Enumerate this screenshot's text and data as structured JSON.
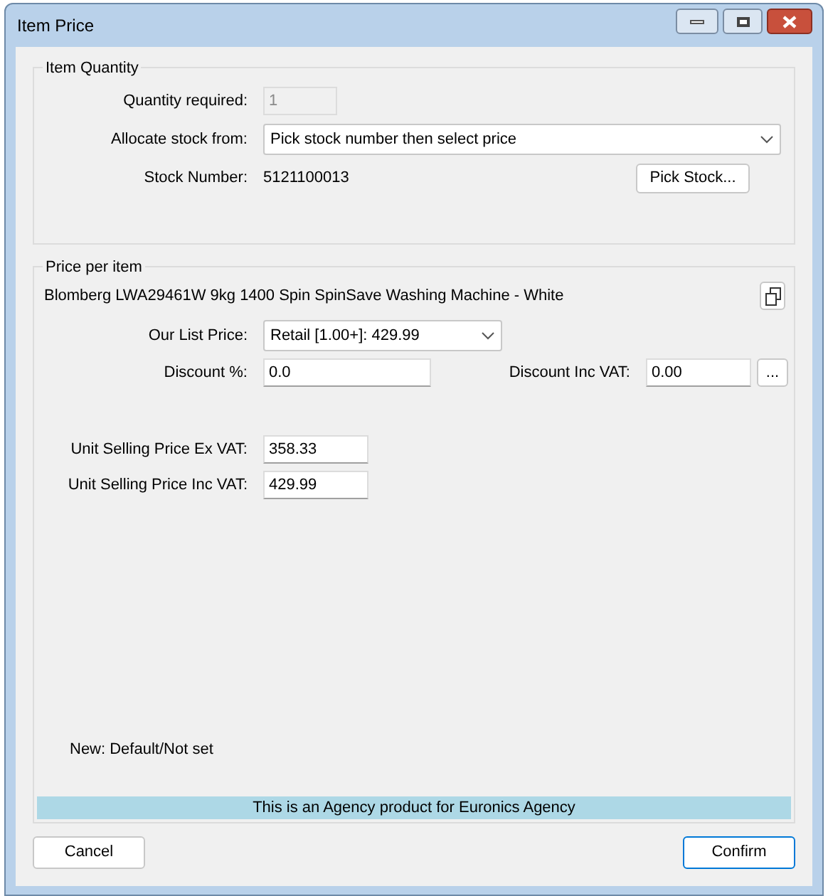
{
  "window": {
    "title": "Item Price"
  },
  "item_quantity": {
    "legend": "Item Quantity",
    "quantity": {
      "label": "Quantity required:",
      "value": "1",
      "disabled": true
    },
    "allocate": {
      "label": "Allocate stock from:",
      "value": "Pick stock number then select price"
    },
    "stock_number": {
      "label": "Stock Number:",
      "value": "5121100013"
    },
    "pick_stock_button": "Pick Stock..."
  },
  "price_per_item": {
    "legend": "Price per item",
    "product_name": "Blomberg LWA29461W 9kg 1400 Spin SpinSave Washing Machine - White",
    "list_price": {
      "label": "Our List Price:",
      "value": "Retail [1.00+]: 429.99"
    },
    "discount_percent": {
      "label": "Discount %:",
      "value": "0.0"
    },
    "discount_inc_vat": {
      "label": "Discount Inc VAT:",
      "value": "0.00"
    },
    "more_button": "...",
    "unit_ex_vat": {
      "label": "Unit Selling Price Ex VAT:",
      "value": "358.33"
    },
    "unit_inc_vat": {
      "label": "Unit Selling Price Inc VAT:",
      "value": "429.99"
    },
    "note": "New: Default/Not set",
    "agency_banner": "This is an Agency product for Euronics Agency"
  },
  "buttons": [
    {
      "label": "Cancel",
      "default": false
    },
    {
      "label": "Confirm",
      "default": true
    }
  ]
}
